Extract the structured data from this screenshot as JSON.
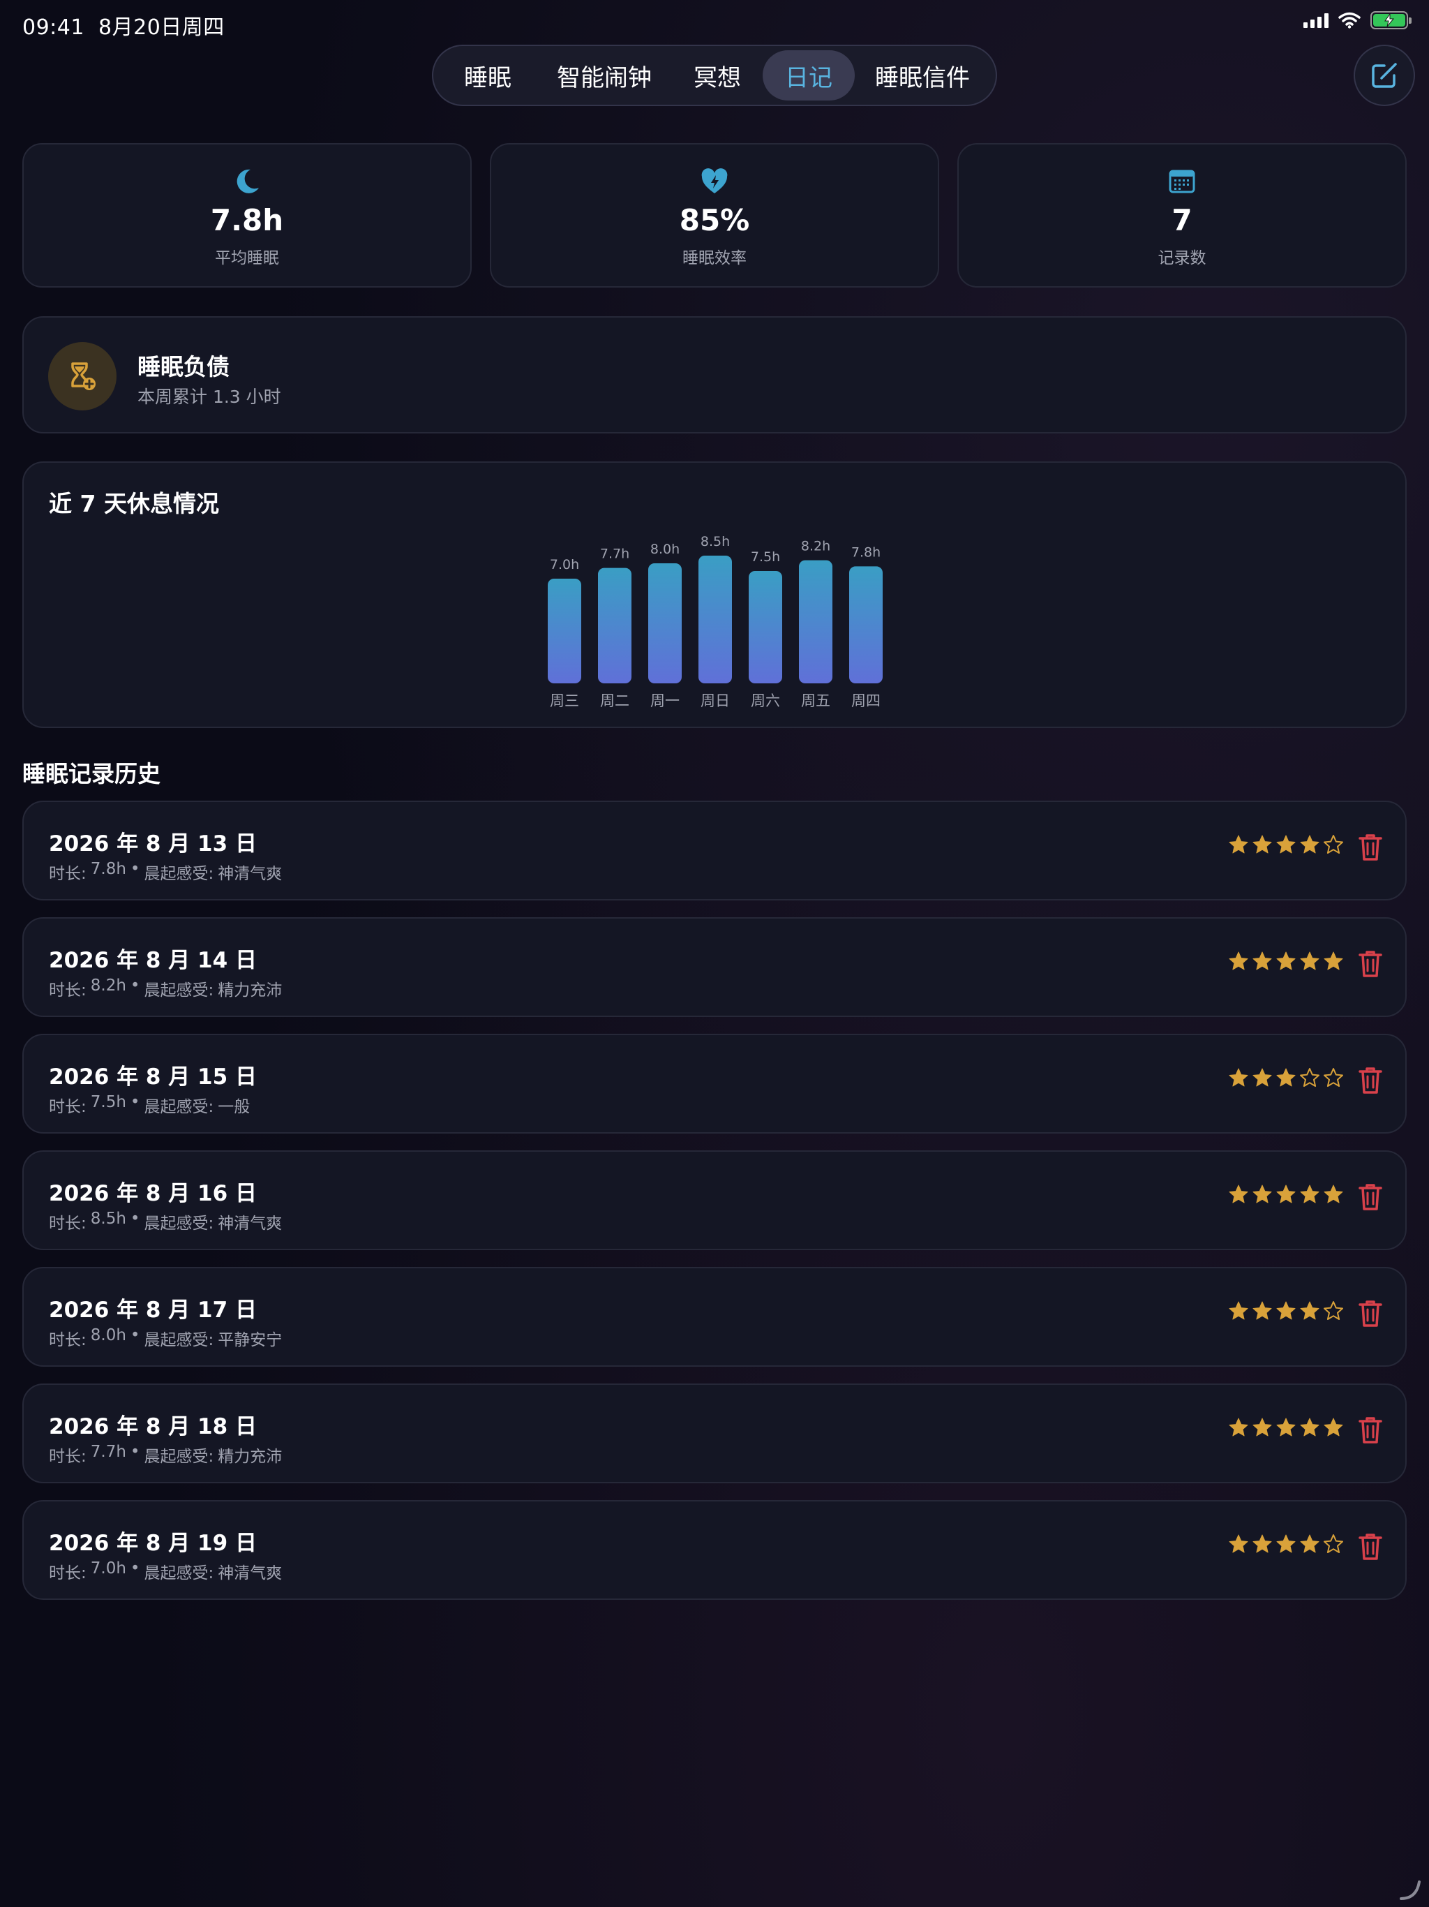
{
  "status_bar": {
    "time": "09:41",
    "date": "8月20日周四"
  },
  "tabs": [
    {
      "label": "睡眠",
      "active": false
    },
    {
      "label": "智能闹钟",
      "active": false
    },
    {
      "label": "冥想",
      "active": false
    },
    {
      "label": "日记",
      "active": true
    },
    {
      "label": "睡眠信件",
      "active": false
    }
  ],
  "stats": [
    {
      "icon": "moon-icon",
      "value": "7.8h",
      "label": "平均睡眠"
    },
    {
      "icon": "heart-bolt-icon",
      "value": "85%",
      "label": "睡眠效率"
    },
    {
      "icon": "calendar-icon",
      "value": "7",
      "label": "记录数"
    }
  ],
  "sleep_debt": {
    "icon": "hourglass-plus-icon",
    "title": "睡眠负债",
    "subtitle": "本周累计 1.3 小时"
  },
  "chart_data": {
    "type": "bar",
    "title": "近 7 天休息情况",
    "categories": [
      "周三",
      "周二",
      "周一",
      "周日",
      "周六",
      "周五",
      "周四"
    ],
    "values": [
      7.0,
      7.7,
      8.0,
      8.5,
      7.5,
      8.2,
      7.8
    ],
    "value_labels": [
      "7.0h",
      "7.7h",
      "8.0h",
      "8.5h",
      "7.5h",
      "8.2h",
      "7.8h"
    ],
    "unit": "h",
    "colors": {
      "top": "#3a9ec4",
      "bottom": "#6070d8"
    }
  },
  "history": {
    "title": "睡眠记录历史",
    "duration_label": "时长:",
    "feeling_label": "晨起感受:",
    "separator": "•",
    "records": [
      {
        "date": "2026 年 8 月 13 日",
        "duration": "7.8h",
        "feeling": "神清气爽",
        "rating": 4
      },
      {
        "date": "2026 年 8 月 14 日",
        "duration": "8.2h",
        "feeling": "精力充沛",
        "rating": 5
      },
      {
        "date": "2026 年 8 月 15 日",
        "duration": "7.5h",
        "feeling": "一般",
        "rating": 3
      },
      {
        "date": "2026 年 8 月 16 日",
        "duration": "8.5h",
        "feeling": "神清气爽",
        "rating": 5
      },
      {
        "date": "2026 年 8 月 17 日",
        "duration": "8.0h",
        "feeling": "平静安宁",
        "rating": 4
      },
      {
        "date": "2026 年 8 月 18 日",
        "duration": "7.7h",
        "feeling": "精力充沛",
        "rating": 5
      },
      {
        "date": "2026 年 8 月 19 日",
        "duration": "7.0h",
        "feeling": "神清气爽",
        "rating": 4
      }
    ]
  },
  "colors": {
    "accent": "#59b4e0",
    "star": "#d9a23a",
    "danger": "#d9414b"
  }
}
